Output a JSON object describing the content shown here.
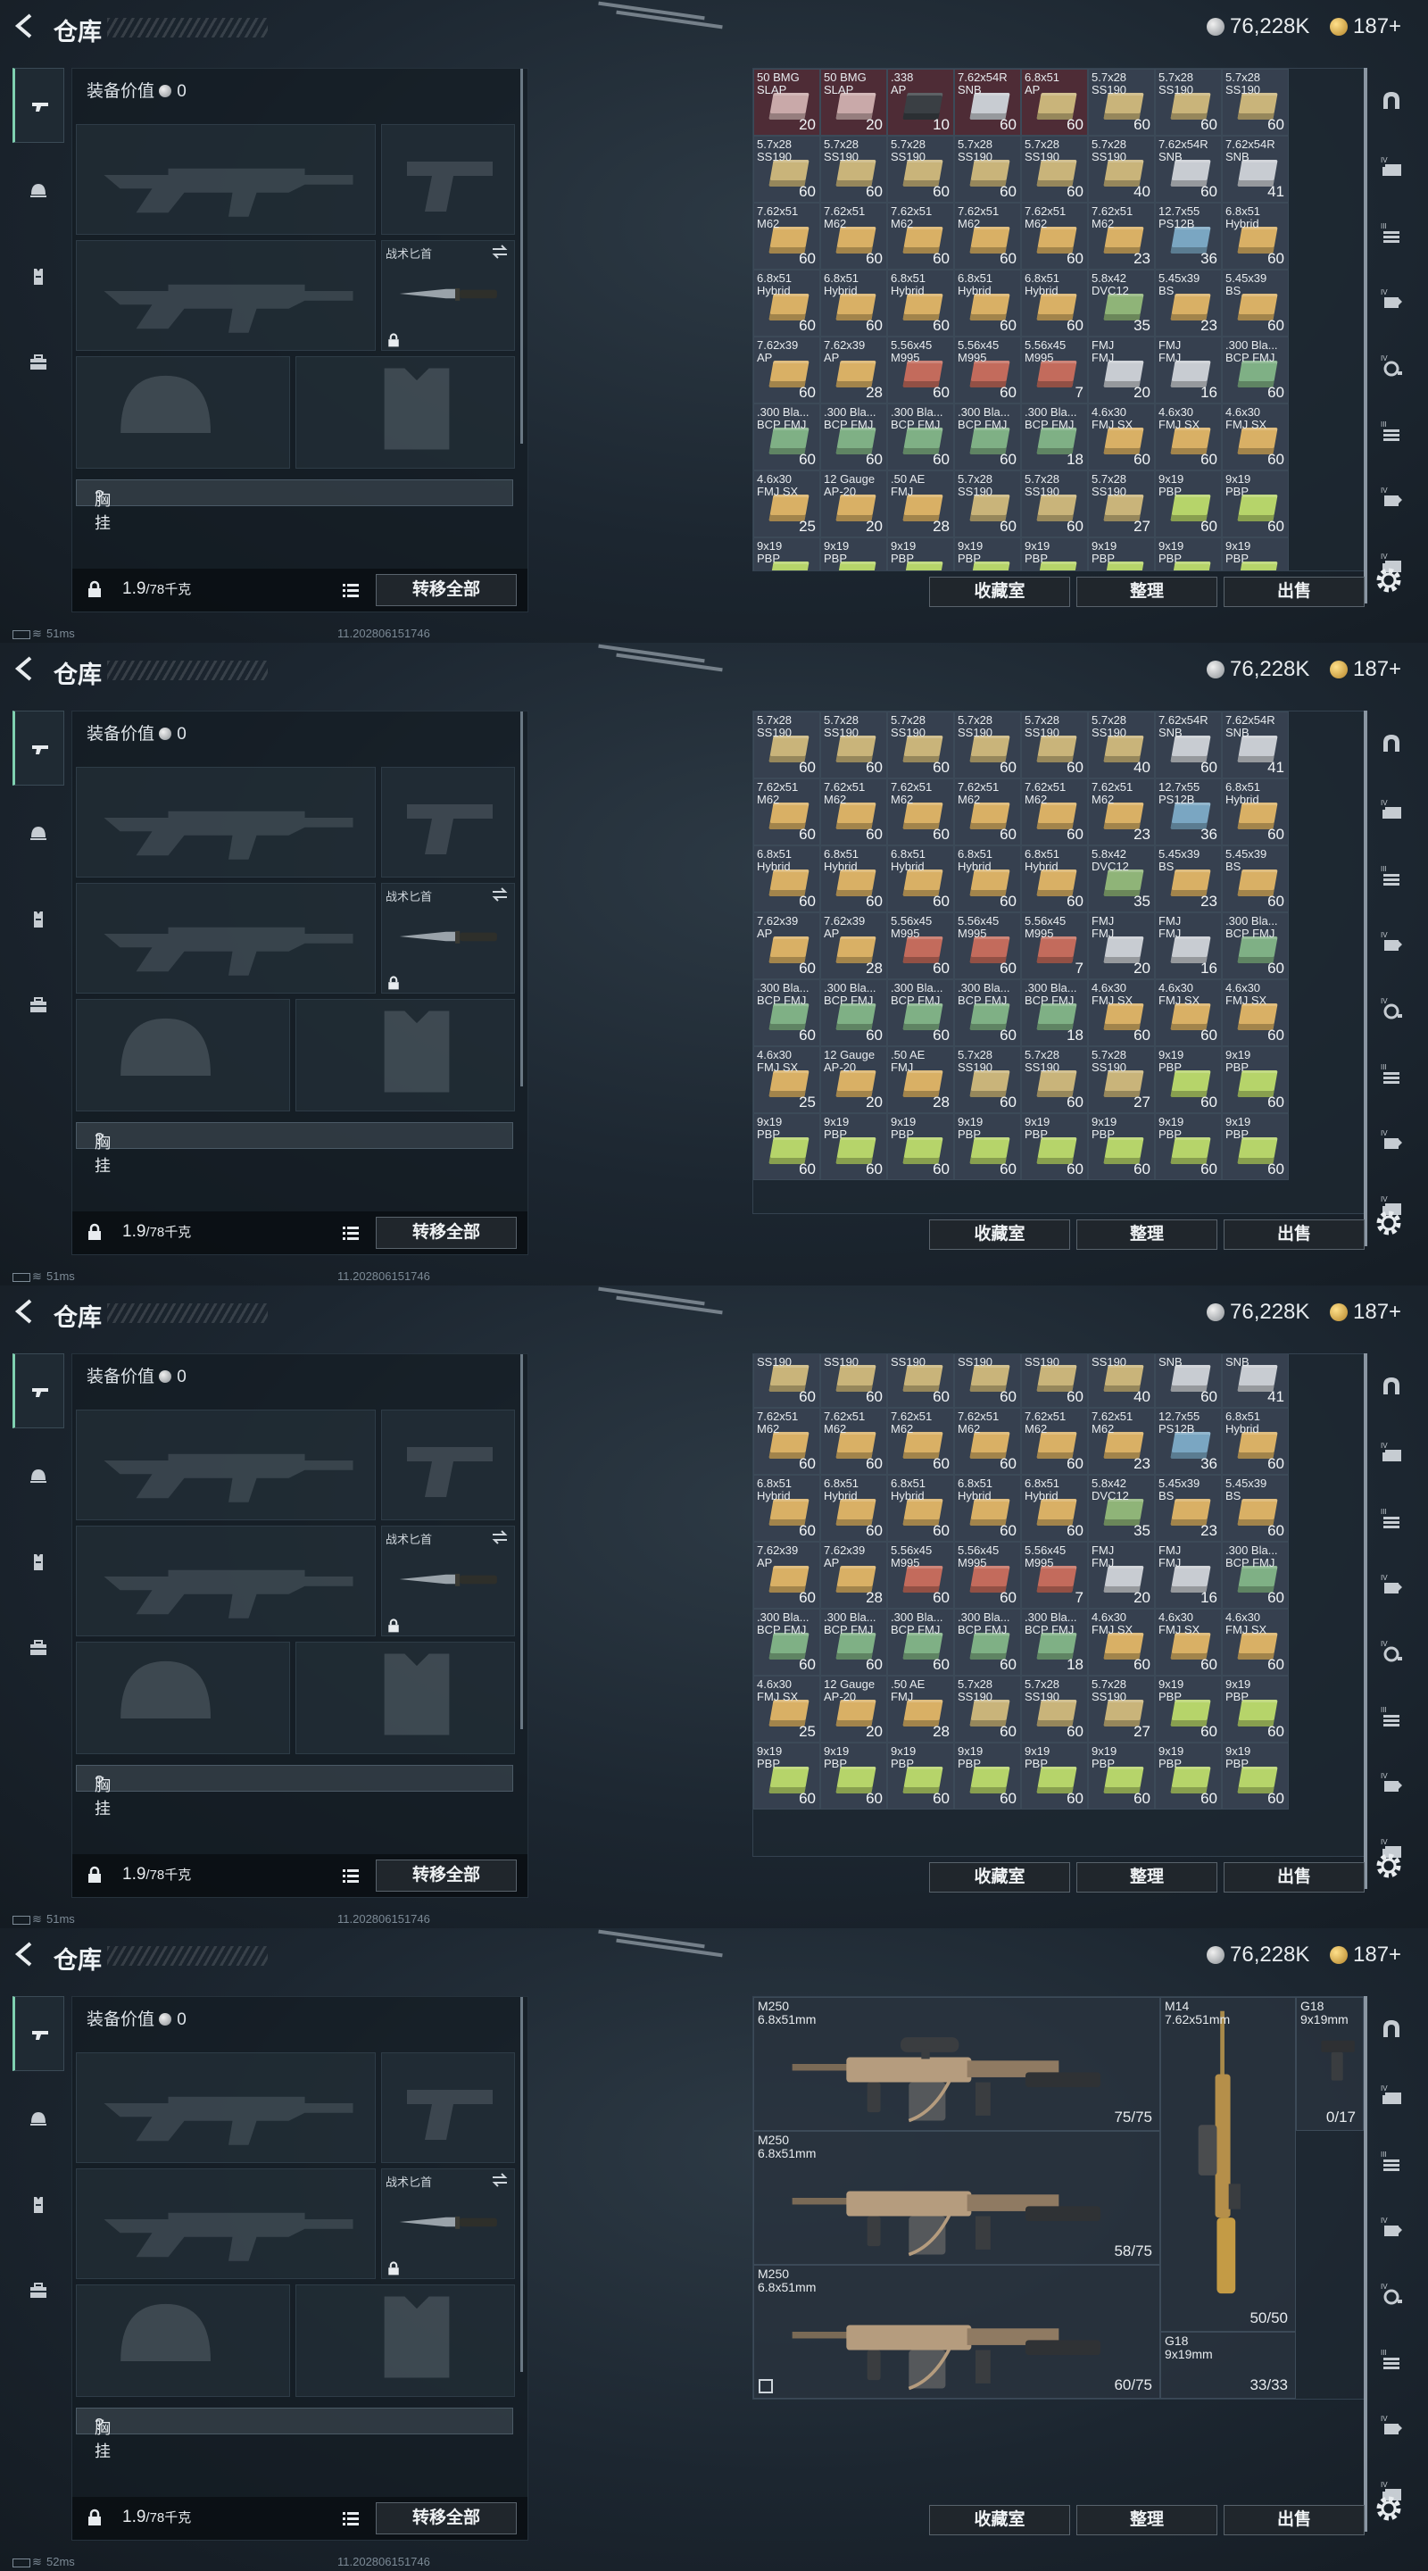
{
  "header": {
    "title": "仓库",
    "silver_amount": "76,228K",
    "gold_amount": "187+"
  },
  "equipment": {
    "value_label": "装备价值",
    "value": "0",
    "knife_label": "战术匕首",
    "chest_label": "胸挂",
    "chest_mark": "?",
    "weight_current": "1.9",
    "weight_max": "/78千克",
    "transfer_all": "转移全部"
  },
  "buttons": {
    "collection": "收藏室",
    "sort": "整理",
    "sell": "出售"
  },
  "status": {
    "pings": [
      "51ms",
      "51ms",
      "51ms",
      "52ms"
    ],
    "build": "11.202806151746"
  },
  "ammo_rows": [
    [
      {
        "n": "50 BMG\nSLAP",
        "c": "20",
        "col": "#c9a9a9",
        "bg": "red"
      },
      {
        "n": "50 BMG\nSLAP",
        "c": "20",
        "col": "#c9a9a9",
        "bg": "red"
      },
      {
        "n": ".338\nAP",
        "c": "10",
        "col": "#3a3f44",
        "bg": "red"
      },
      {
        "n": "7.62x54R\nSNB",
        "c": "60",
        "col": "#c8ccd2",
        "bg": "red"
      },
      {
        "n": "6.8x51\nAP",
        "c": "60",
        "col": "#c9b47a",
        "bg": "red"
      },
      {
        "n": "5.7x28\nSS190",
        "c": "60",
        "col": "#c9b47a",
        "bg": ""
      },
      {
        "n": "5.7x28\nSS190",
        "c": "60",
        "col": "#c9b47a",
        "bg": ""
      },
      {
        "n": "5.7x28\nSS190",
        "c": "60",
        "col": "#c9b47a",
        "bg": ""
      }
    ],
    [
      {
        "n": "5.7x28\nSS190",
        "c": "60",
        "col": "#c9b47a",
        "bg": ""
      },
      {
        "n": "5.7x28\nSS190",
        "c": "60",
        "col": "#c9b47a",
        "bg": ""
      },
      {
        "n": "5.7x28\nSS190",
        "c": "60",
        "col": "#c9b47a",
        "bg": ""
      },
      {
        "n": "5.7x28\nSS190",
        "c": "60",
        "col": "#c9b47a",
        "bg": ""
      },
      {
        "n": "5.7x28\nSS190",
        "c": "60",
        "col": "#c9b47a",
        "bg": ""
      },
      {
        "n": "5.7x28\nSS190",
        "c": "40",
        "col": "#c9b47a",
        "bg": ""
      },
      {
        "n": "7.62x54R\nSNB",
        "c": "60",
        "col": "#c8ccd2",
        "bg": ""
      },
      {
        "n": "7.62x54R\nSNB",
        "c": "41",
        "col": "#c8ccd2",
        "bg": ""
      }
    ],
    [
      {
        "n": "7.62x51\nM62",
        "c": "60",
        "col": "#d9b065",
        "bg": ""
      },
      {
        "n": "7.62x51\nM62",
        "c": "60",
        "col": "#d9b065",
        "bg": ""
      },
      {
        "n": "7.62x51\nM62",
        "c": "60",
        "col": "#d9b065",
        "bg": ""
      },
      {
        "n": "7.62x51\nM62",
        "c": "60",
        "col": "#d9b065",
        "bg": ""
      },
      {
        "n": "7.62x51\nM62",
        "c": "60",
        "col": "#d9b065",
        "bg": ""
      },
      {
        "n": "7.62x51\nM62",
        "c": "23",
        "col": "#d9b065",
        "bg": ""
      },
      {
        "n": "12.7x55\nPS12B",
        "c": "36",
        "col": "#7aa6c2",
        "bg": ""
      },
      {
        "n": "6.8x51\nHybrid",
        "c": "60",
        "col": "#d9b065",
        "bg": ""
      }
    ],
    [
      {
        "n": "6.8x51\nHybrid",
        "c": "60",
        "col": "#d9b065",
        "bg": ""
      },
      {
        "n": "6.8x51\nHybrid",
        "c": "60",
        "col": "#d9b065",
        "bg": ""
      },
      {
        "n": "6.8x51\nHybrid",
        "c": "60",
        "col": "#d9b065",
        "bg": ""
      },
      {
        "n": "6.8x51\nHybrid",
        "c": "60",
        "col": "#d9b065",
        "bg": ""
      },
      {
        "n": "6.8x51\nHybrid",
        "c": "60",
        "col": "#d9b065",
        "bg": ""
      },
      {
        "n": "5.8x42\nDVC12",
        "c": "35",
        "col": "#8fb478",
        "bg": ""
      },
      {
        "n": "5.45x39\nBS",
        "c": "23",
        "col": "#d9b065",
        "bg": ""
      },
      {
        "n": "5.45x39\nBS",
        "c": "60",
        "col": "#d9b065",
        "bg": ""
      }
    ],
    [
      {
        "n": "7.62x39\nAP",
        "c": "60",
        "col": "#d9b065",
        "bg": ""
      },
      {
        "n": "7.62x39\nAP",
        "c": "28",
        "col": "#d9b065",
        "bg": ""
      },
      {
        "n": "5.56x45\nM995",
        "c": "60",
        "col": "#c36b5c",
        "bg": ""
      },
      {
        "n": "5.56x45\nM995",
        "c": "60",
        "col": "#c36b5c",
        "bg": ""
      },
      {
        "n": "5.56x45\nM995",
        "c": "7",
        "col": "#c36b5c",
        "bg": ""
      },
      {
        "n": "FMJ\nFMJ",
        "c": "20",
        "col": "#c8ccd2",
        "bg": ""
      },
      {
        "n": "FMJ\nFMJ",
        "c": "16",
        "col": "#c8ccd2",
        "bg": ""
      },
      {
        "n": ".300 Bla...\nBCP FMJ",
        "c": "60",
        "col": "#7fb085",
        "bg": ""
      }
    ],
    [
      {
        "n": ".300 Bla...\nBCP FMJ",
        "c": "60",
        "col": "#7fb085",
        "bg": ""
      },
      {
        "n": ".300 Bla...\nBCP FMJ",
        "c": "60",
        "col": "#7fb085",
        "bg": ""
      },
      {
        "n": ".300 Bla...\nBCP FMJ",
        "c": "60",
        "col": "#7fb085",
        "bg": ""
      },
      {
        "n": ".300 Bla...\nBCP FMJ",
        "c": "60",
        "col": "#7fb085",
        "bg": ""
      },
      {
        "n": ".300 Bla...\nBCP FMJ",
        "c": "18",
        "col": "#7fb085",
        "bg": ""
      },
      {
        "n": "4.6x30\nFMJ SX",
        "c": "60",
        "col": "#d9b065",
        "bg": ""
      },
      {
        "n": "4.6x30\nFMJ SX",
        "c": "60",
        "col": "#d9b065",
        "bg": ""
      },
      {
        "n": "4.6x30\nFMJ SX",
        "c": "60",
        "col": "#d9b065",
        "bg": ""
      }
    ],
    [
      {
        "n": "4.6x30\nFMJ SX",
        "c": "25",
        "col": "#d9b065",
        "bg": ""
      },
      {
        "n": "12 Gauge\nAP-20",
        "c": "20",
        "col": "#d9b065",
        "bg": ""
      },
      {
        "n": ".50 AE\nFMJ",
        "c": "28",
        "col": "#d9b065",
        "bg": ""
      },
      {
        "n": "5.7x28\nSS190",
        "c": "60",
        "col": "#c9b47a",
        "bg": ""
      },
      {
        "n": "5.7x28\nSS190",
        "c": "60",
        "col": "#c9b47a",
        "bg": ""
      },
      {
        "n": "5.7x28\nSS190",
        "c": "27",
        "col": "#c9b47a",
        "bg": ""
      },
      {
        "n": "9x19\nPBP",
        "c": "60",
        "col": "#b6d46a",
        "bg": ""
      },
      {
        "n": "9x19\nPBP",
        "c": "60",
        "col": "#b6d46a",
        "bg": ""
      }
    ],
    [
      {
        "n": "9x19\nPBP",
        "c": "60",
        "col": "#b6d46a",
        "bg": ""
      },
      {
        "n": "9x19\nPBP",
        "c": "60",
        "col": "#b6d46a",
        "bg": ""
      },
      {
        "n": "9x19\nPBP",
        "c": "60",
        "col": "#b6d46a",
        "bg": ""
      },
      {
        "n": "9x19\nPBP",
        "c": "60",
        "col": "#b6d46a",
        "bg": ""
      },
      {
        "n": "9x19\nPBP",
        "c": "60",
        "col": "#b6d46a",
        "bg": ""
      },
      {
        "n": "9x19\nPBP",
        "c": "60",
        "col": "#b6d46a",
        "bg": ""
      },
      {
        "n": "9x19\nPBP",
        "c": "60",
        "col": "#b6d46a",
        "bg": ""
      },
      {
        "n": "9x19\nPBP",
        "c": "60",
        "col": "#b6d46a",
        "bg": ""
      }
    ]
  ],
  "weapons": [
    {
      "name": "M250",
      "caliber": "6.8x51mm",
      "ammo": "75/75",
      "type": "lmg-scope"
    },
    {
      "name": "M250",
      "caliber": "6.8x51mm",
      "ammo": "58/75",
      "type": "lmg"
    },
    {
      "name": "M250",
      "caliber": "6.8x51mm",
      "ammo": "60/75",
      "type": "lmg"
    },
    {
      "name": "M14",
      "caliber": "7.62x51mm",
      "ammo": "50/50",
      "type": "rifle"
    },
    {
      "name": "G18",
      "caliber": "9x19mm",
      "ammo": "0/17",
      "type": "pistol"
    },
    {
      "name": "G18",
      "caliber": "9x19mm",
      "ammo": "33/33",
      "type": "pistol"
    }
  ]
}
